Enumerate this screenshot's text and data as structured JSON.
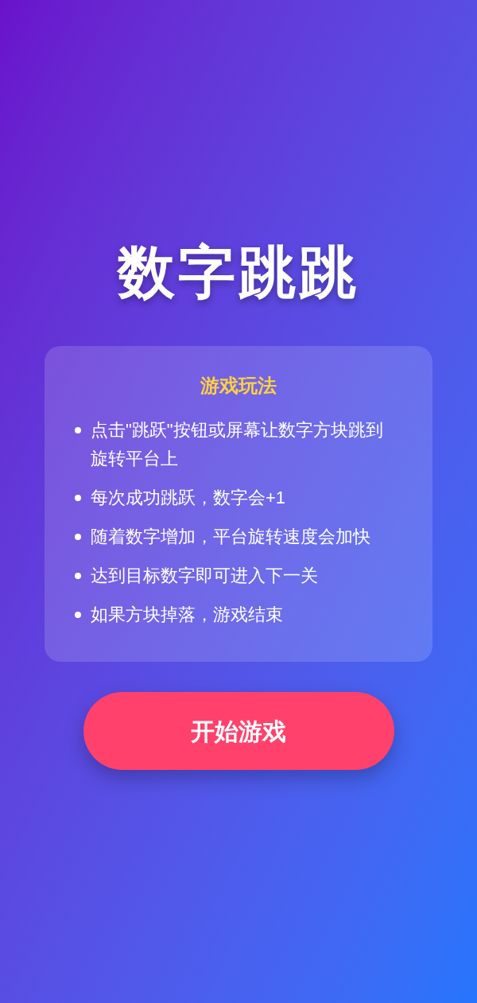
{
  "title": "数字跳跳",
  "rules": {
    "heading": "游戏玩法",
    "items": [
      "点击\"跳跃\"按钮或屏幕让数字方块跳到旋转平台上",
      "每次成功跳跃，数字会+1",
      "随着数字增加，平台旋转速度会加快",
      "达到目标数字即可进入下一关",
      "如果方块掉落，游戏结束"
    ]
  },
  "start_button": "开始游戏"
}
